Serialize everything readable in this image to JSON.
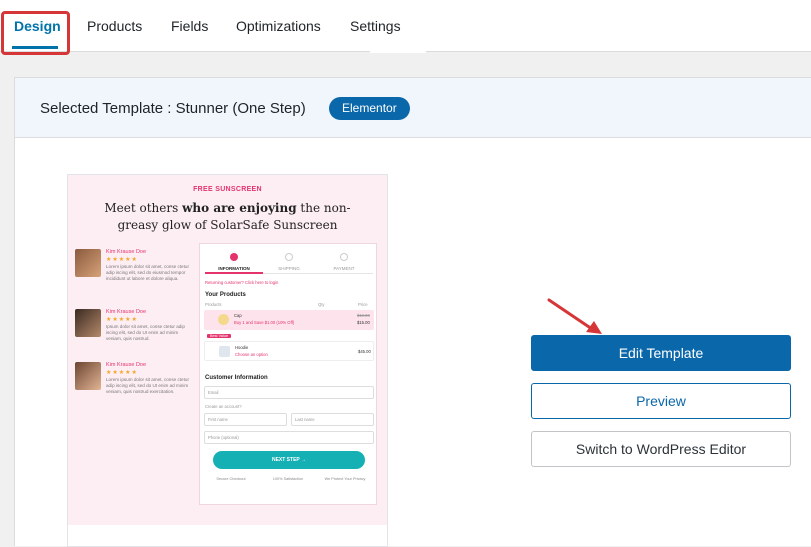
{
  "tabs": [
    {
      "label": "Design",
      "active": true
    },
    {
      "label": "Products"
    },
    {
      "label": "Fields"
    },
    {
      "label": "Optimizations"
    },
    {
      "label": "Settings"
    }
  ],
  "header": {
    "selected_label": "Selected Template :  Stunner  (One Step)",
    "badge": "Elementor"
  },
  "preview": {
    "eyebrow": "FREE SUNSCREEN",
    "headline_1": "Meet others ",
    "headline_bold": "who are enjoying",
    "headline_2": " the non-greasy glow of SolarSafe Sunscreen",
    "reviews": [
      {
        "name": "Kim Krause Doe",
        "stars": "★★★★★",
        "text": "Lorem ipsum dolor sit amet, conse ctetur adip iscing elit, sed do eiusmod tempor incididunt ut labore et dolore aliqua."
      },
      {
        "name": "Kim Krause Doe",
        "stars": "★★★★★",
        "text": "Ipsum dolor sit amet, conse ctetur adip iscing elit, sed do Ut enim ad minim veniam, quis nostrud."
      },
      {
        "name": "Kim Krause Doe",
        "stars": "★★★★★",
        "text": "Lorem ipsum dolor sit amet, conse ctetur adip iscing elit, sed do Ut enim ad minim veniam, quis nostrud exercitation."
      }
    ],
    "checkout": {
      "steps": [
        "INFORMATION",
        "SHIPPING",
        "PAYMENT"
      ],
      "returning": "Returning customer? Click here to login",
      "your_products": "Your Products",
      "col_products": "Products",
      "col_qty": "Qty",
      "col_price": "Price",
      "product_1": "Cap",
      "product_1_note": "Buy 1 and Save $1.00 (10% Off)",
      "product_1_price": "$19.00",
      "product_1_sale": "$15.00",
      "product_2": "Hoodie",
      "product_2_note": "Choose an option",
      "product_2_price": "$45.00",
      "best_value": "Best Value",
      "customer_info": "Customer Information",
      "email": "Email",
      "create_account": "Create an account?",
      "first_name": "First name",
      "last_name": "Last name",
      "phone": "Phone (optional)",
      "next_step": "NEXT STEP →",
      "trust": [
        "Secure Checkout",
        "100% Satisfaction",
        "We Protect Your Privacy"
      ]
    }
  },
  "buttons": {
    "edit": "Edit Template",
    "preview": "Preview",
    "switch": "Switch to WordPress Editor"
  },
  "colors": {
    "accent": "#0a67a9",
    "highlight": "#d63638",
    "brand_pink": "#e5336c",
    "cta_teal": "#14b0b4"
  }
}
